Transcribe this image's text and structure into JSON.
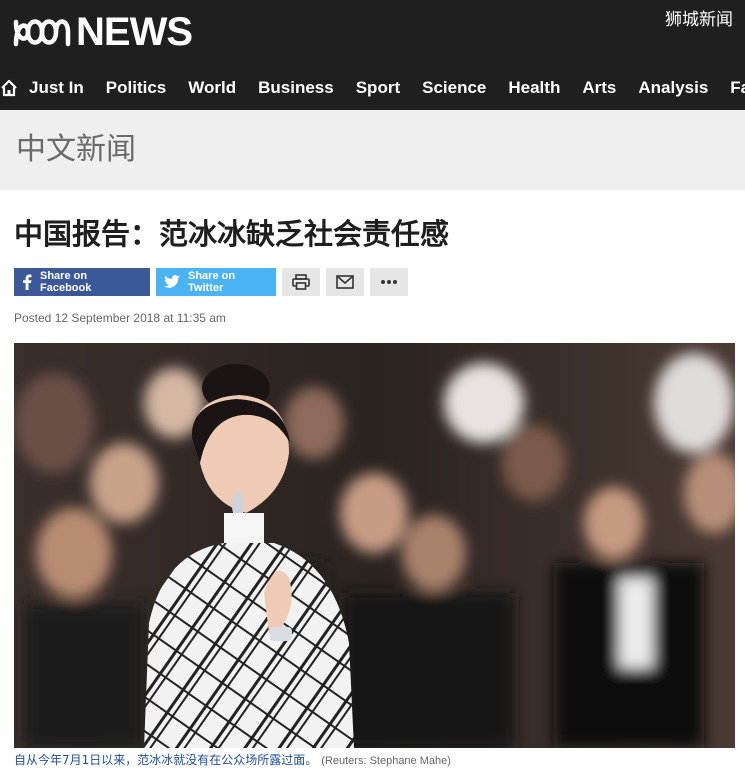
{
  "header": {
    "logo_text": "NEWS",
    "edition": "狮城新闻"
  },
  "nav": {
    "items": [
      {
        "label": "Just In"
      },
      {
        "label": "Politics"
      },
      {
        "label": "World"
      },
      {
        "label": "Business"
      },
      {
        "label": "Sport"
      },
      {
        "label": "Science"
      },
      {
        "label": "Health"
      },
      {
        "label": "Arts"
      },
      {
        "label": "Analysis"
      },
      {
        "label": "Fact C"
      }
    ]
  },
  "section": {
    "title": "中文新闻"
  },
  "article": {
    "headline": "中国报告：范冰冰缺乏社会责任感",
    "share": {
      "facebook_label": "Share on Facebook",
      "twitter_label": "Share on Twitter"
    },
    "posted": "Posted 12 September 2018 at 11:35 am",
    "caption": "自从今年7月1日以来，范冰冰就没有在公众场所露过面。",
    "credit": "(Reuters: Stephane Mahe)"
  },
  "colors": {
    "header_bg": "#1f1f1f",
    "facebook": "#3b5998",
    "twitter": "#4ab3f4",
    "caption_link": "#1f4f99"
  },
  "icons": [
    "home-icon",
    "facebook-icon",
    "twitter-icon",
    "print-icon",
    "email-icon",
    "more-icon"
  ]
}
